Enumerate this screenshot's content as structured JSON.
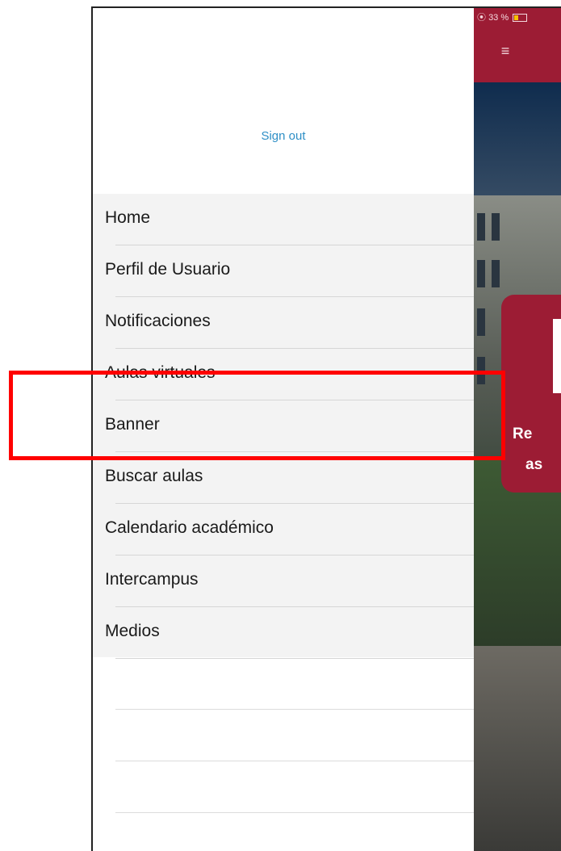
{
  "status_bar": {
    "battery_text": "33 %"
  },
  "drawer": {
    "sign_out_label": "Sign out",
    "items": [
      {
        "label": "Home"
      },
      {
        "label": "Perfil de Usuario"
      },
      {
        "label": "Notificaciones"
      },
      {
        "label": "Aulas virtuales"
      },
      {
        "label": "Banner"
      },
      {
        "label": "Buscar aulas"
      },
      {
        "label": "Calendario académico"
      },
      {
        "label": "Intercampus"
      },
      {
        "label": "Medios"
      }
    ]
  },
  "app_card": {
    "line1": "Re",
    "line2": "as"
  },
  "colors": {
    "brand_red": "#9c1c34",
    "link_blue": "#2e8fc6",
    "highlight": "#ff0000"
  }
}
